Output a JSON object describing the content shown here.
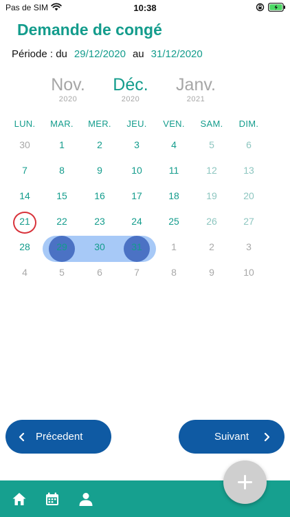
{
  "status_bar": {
    "carrier": "Pas de SIM",
    "time": "10:38"
  },
  "header": {
    "title": "Demande de congé",
    "period_label": "Période : du",
    "start_date": "29/12/2020",
    "to_label": "au",
    "end_date": "31/12/2020"
  },
  "months": {
    "prev": {
      "name": "Nov.",
      "year": "2020"
    },
    "current": {
      "name": "Déc.",
      "year": "2020"
    },
    "next": {
      "name": "Janv.",
      "year": "2021"
    }
  },
  "weekdays": [
    "LUN.",
    "MAR.",
    "MER.",
    "JEU.",
    "VEN.",
    "SAM.",
    "DIM."
  ],
  "calendar": {
    "weeks": [
      [
        "30",
        "1",
        "2",
        "3",
        "4",
        "5",
        "6"
      ],
      [
        "7",
        "8",
        "9",
        "10",
        "11",
        "12",
        "13"
      ],
      [
        "14",
        "15",
        "16",
        "17",
        "18",
        "19",
        "20"
      ],
      [
        "21",
        "22",
        "23",
        "24",
        "25",
        "26",
        "27"
      ],
      [
        "28",
        "29",
        "30",
        "31",
        "1",
        "2",
        "3"
      ],
      [
        "4",
        "5",
        "6",
        "7",
        "8",
        "9",
        "10"
      ]
    ],
    "today": "21",
    "selected_start": "29",
    "selected_end": "31"
  },
  "buttons": {
    "previous": "Précedent",
    "next": "Suivant"
  },
  "icons": {
    "tabs": [
      "home-icon",
      "calendar-icon",
      "person-icon"
    ],
    "fab": "plus-icon"
  },
  "colors": {
    "accent": "#139c8c",
    "button": "#0f5aa3",
    "tab_bar": "#16a08f",
    "range": "#a7c9f7",
    "range_end": "#4b72c4",
    "today_ring": "#d8323a"
  }
}
